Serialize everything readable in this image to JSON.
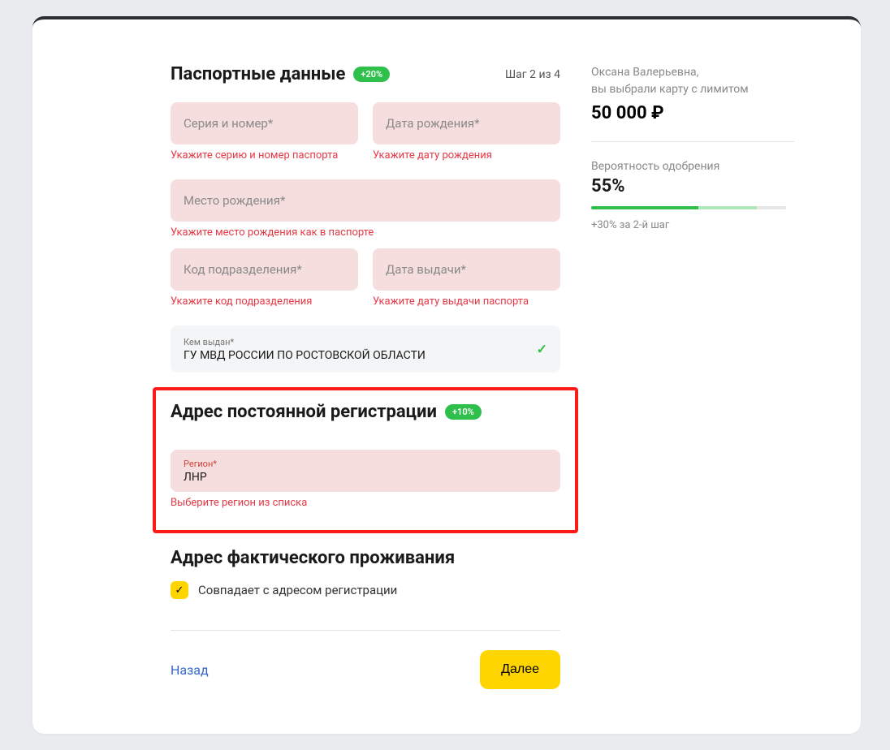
{
  "header": {
    "title": "Паспортные данные",
    "badge": "+20%",
    "step": "Шаг 2 из 4"
  },
  "fields": {
    "series": {
      "placeholder": "Серия и номер*",
      "error": "Укажите серию и номер паспорта"
    },
    "birthdate": {
      "placeholder": "Дата рождения*",
      "error": "Укажите дату рождения"
    },
    "birthplace": {
      "placeholder": "Место рождения*",
      "error": "Укажите место рождения как в паспорте"
    },
    "divcode": {
      "placeholder": "Код подразделения*",
      "error": "Укажите код подразделения"
    },
    "issuedate": {
      "placeholder": "Дата выдачи*",
      "error": "Укажите дату выдачи паспорта"
    },
    "issuedby": {
      "label": "Кем выдан*",
      "value": "ГУ МВД РОССИИ ПО РОСТОВСКОЙ ОБЛАСТИ"
    }
  },
  "address_reg": {
    "title": "Адрес постоянной регистрации",
    "badge": "+10%",
    "region": {
      "label": "Регион*",
      "value": "ЛНР",
      "error": "Выберите регион из списка"
    }
  },
  "address_live": {
    "title": "Адрес фактического проживания",
    "checkbox_label": "Совпадает с адресом регистрации"
  },
  "footer": {
    "back": "Назад",
    "next": "Далее"
  },
  "sidebar": {
    "greeting": "Оксана Валерьевна,",
    "subline": "вы выбрали карту с лимитом",
    "amount": "50 000 ₽",
    "prob_label": "Вероятность одобрения",
    "prob_value": "55%",
    "hint": "+30% за 2-й шаг"
  }
}
